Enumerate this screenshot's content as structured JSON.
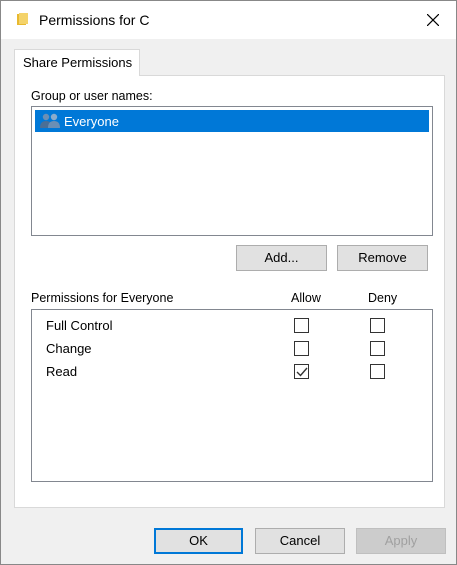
{
  "window": {
    "title": "Permissions for C"
  },
  "tabs": [
    {
      "label": "Share Permissions"
    }
  ],
  "group_section": {
    "label": "Group or user names:",
    "users": [
      {
        "name": "Everyone",
        "selected": true
      }
    ]
  },
  "group_buttons": {
    "add": "Add...",
    "remove": "Remove"
  },
  "permissions": {
    "header": "Permissions for Everyone",
    "allow_header": "Allow",
    "deny_header": "Deny",
    "rows": [
      {
        "name": "Full Control",
        "allow": false,
        "deny": false
      },
      {
        "name": "Change",
        "allow": false,
        "deny": false
      },
      {
        "name": "Read",
        "allow": true,
        "deny": false
      }
    ]
  },
  "footer": {
    "ok": "OK",
    "cancel": "Cancel",
    "apply": "Apply"
  },
  "colors": {
    "selection": "#0078d7",
    "button_bg": "#e1e1e1",
    "window_bg": "#f0f0f0"
  }
}
